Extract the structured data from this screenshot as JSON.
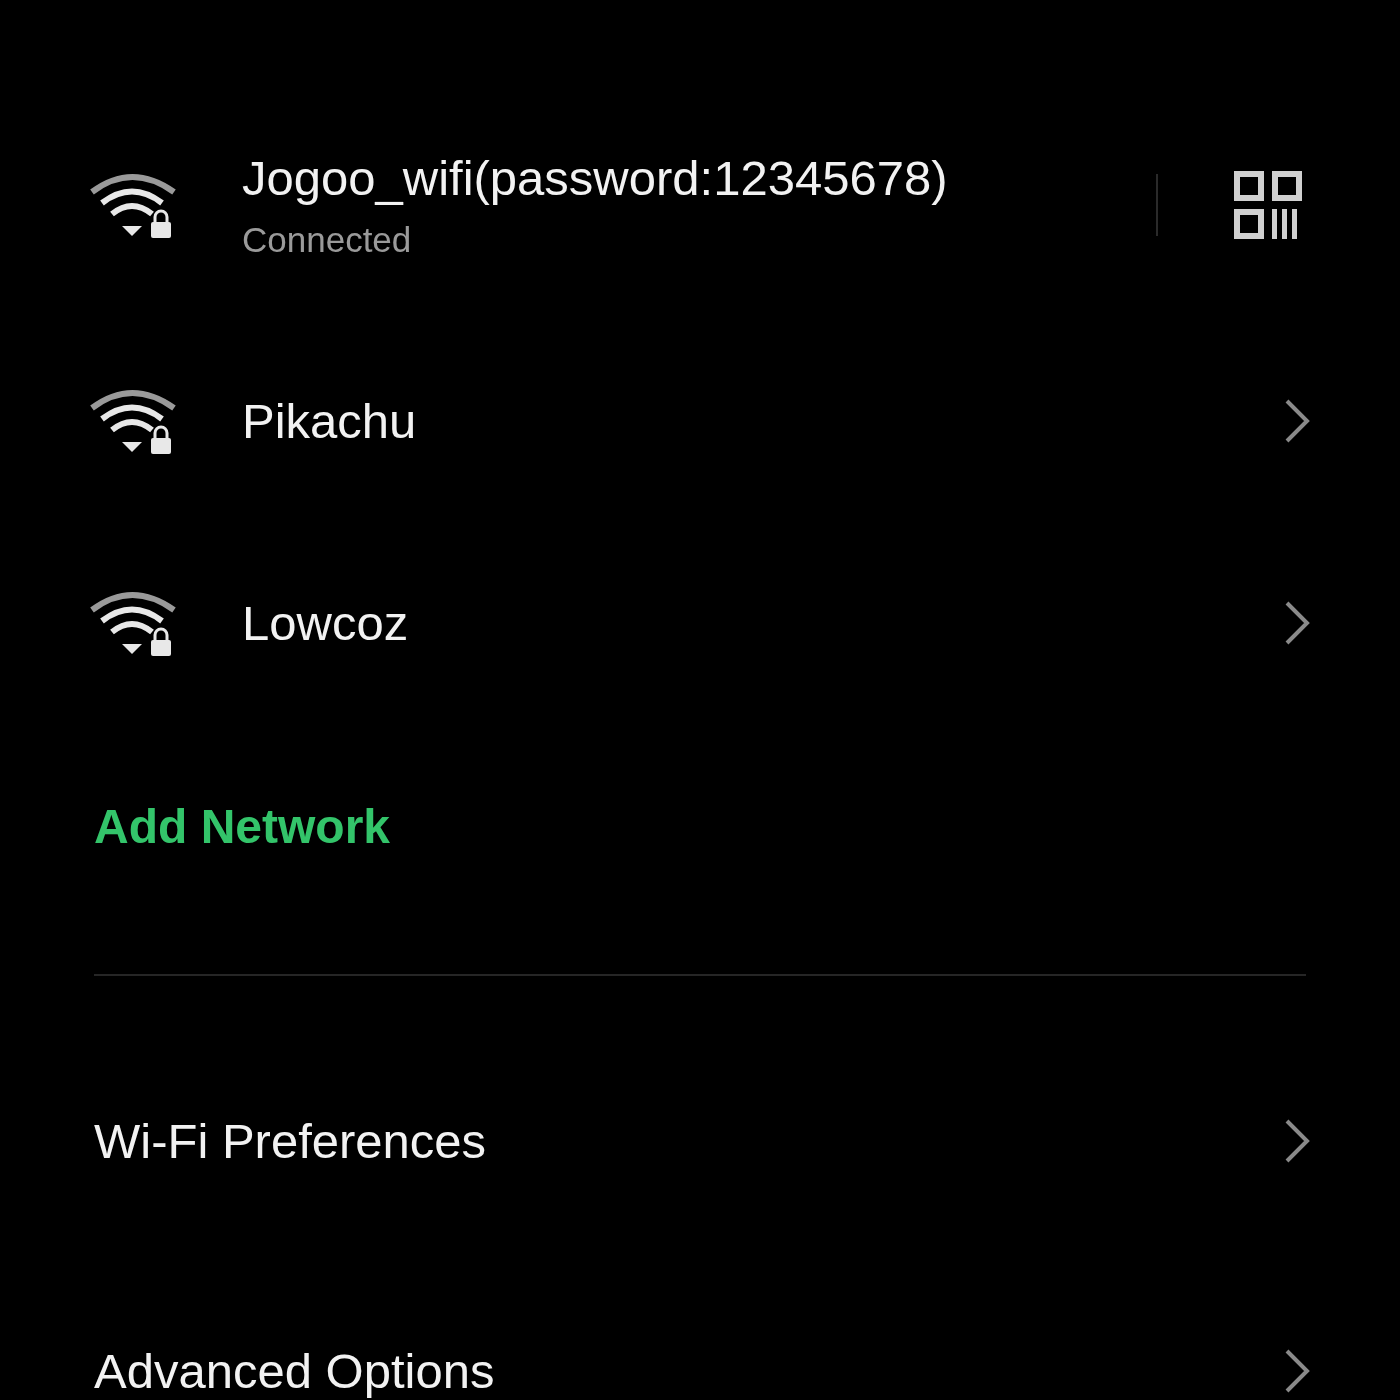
{
  "networks": [
    {
      "kind": "connected",
      "name": "Jogoo_wifi(password:12345678)",
      "status": "Connected"
    },
    {
      "kind": "saved",
      "name": "Pikachu"
    },
    {
      "kind": "saved",
      "name": "Lowcoz"
    }
  ],
  "add_network": "Add Network",
  "settings": [
    {
      "label": "Wi-Fi Preferences"
    },
    {
      "label": "Advanced Options"
    }
  ]
}
